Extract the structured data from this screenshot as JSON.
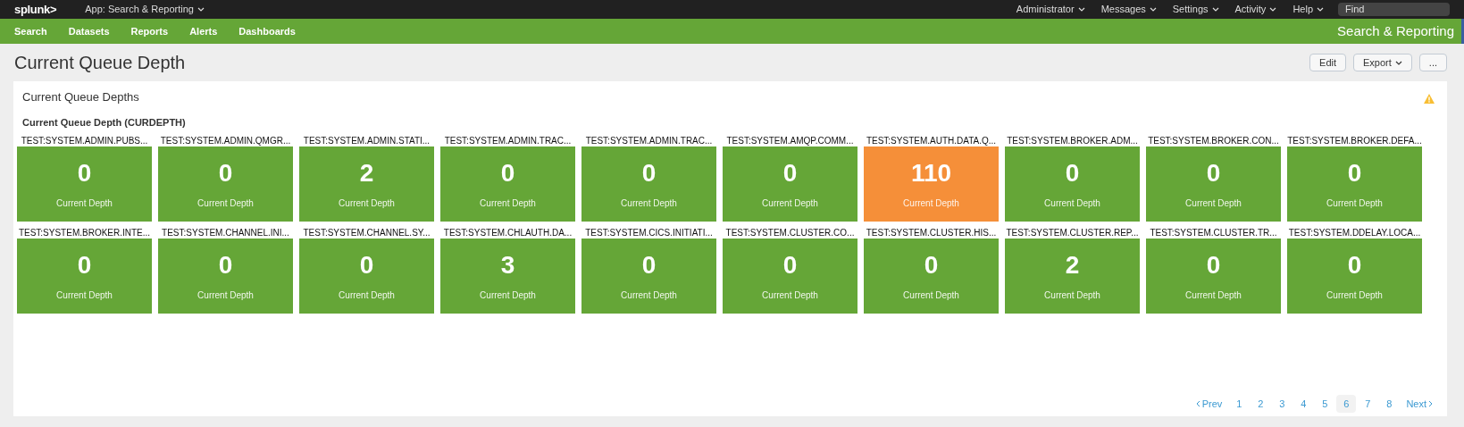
{
  "app_bar": {
    "logo": "splunk>",
    "app_menu": "App: Search & Reporting",
    "menus": [
      "Administrator",
      "Messages",
      "Settings",
      "Activity",
      "Help"
    ],
    "search": {
      "placeholder": "Find"
    }
  },
  "nav": {
    "items": [
      "Search",
      "Datasets",
      "Reports",
      "Alerts",
      "Dashboards"
    ],
    "app_title": "Search & Reporting"
  },
  "dashboard": {
    "title": "Current Queue Depth",
    "buttons": [
      {
        "label": "Edit",
        "kind": "plain"
      },
      {
        "label": "Export",
        "kind": "menu"
      },
      {
        "label": "...",
        "kind": "plain"
      }
    ]
  },
  "panel": {
    "title": "Current Queue Depths",
    "subtitle": "Current Queue Depth (CURDEPTH)",
    "warning": true,
    "tiles": [
      {
        "name": "TEST:SYSTEM.ADMIN.PUBS...",
        "value": "0",
        "caption": "Current Depth",
        "color": "#65a637"
      },
      {
        "name": "TEST:SYSTEM.ADMIN.QMGR...",
        "value": "0",
        "caption": "Current Depth",
        "color": "#65a637"
      },
      {
        "name": "TEST:SYSTEM.ADMIN.STATI...",
        "value": "2",
        "caption": "Current Depth",
        "color": "#65a637"
      },
      {
        "name": "TEST:SYSTEM.ADMIN.TRAC...",
        "value": "0",
        "caption": "Current Depth",
        "color": "#65a637"
      },
      {
        "name": "TEST:SYSTEM.ADMIN.TRAC...",
        "value": "0",
        "caption": "Current Depth",
        "color": "#65a637"
      },
      {
        "name": "TEST:SYSTEM.AMQP.COMM...",
        "value": "0",
        "caption": "Current Depth",
        "color": "#65a637"
      },
      {
        "name": "TEST:SYSTEM.AUTH.DATA.Q...",
        "value": "110",
        "caption": "Current Depth",
        "color": "#f58f39"
      },
      {
        "name": "TEST:SYSTEM.BROKER.ADM...",
        "value": "0",
        "caption": "Current Depth",
        "color": "#65a637"
      },
      {
        "name": "TEST:SYSTEM.BROKER.CON...",
        "value": "0",
        "caption": "Current Depth",
        "color": "#65a637"
      },
      {
        "name": "TEST:SYSTEM.BROKER.DEFA...",
        "value": "0",
        "caption": "Current Depth",
        "color": "#65a637"
      },
      {
        "name": "TEST:SYSTEM.BROKER.INTE...",
        "value": "0",
        "caption": "Current Depth",
        "color": "#65a637"
      },
      {
        "name": "TEST:SYSTEM.CHANNEL.INI...",
        "value": "0",
        "caption": "Current Depth",
        "color": "#65a637"
      },
      {
        "name": "TEST:SYSTEM.CHANNEL.SY...",
        "value": "0",
        "caption": "Current Depth",
        "color": "#65a637"
      },
      {
        "name": "TEST:SYSTEM.CHLAUTH.DA...",
        "value": "3",
        "caption": "Current Depth",
        "color": "#65a637"
      },
      {
        "name": "TEST:SYSTEM.CICS.INITIATI...",
        "value": "0",
        "caption": "Current Depth",
        "color": "#65a637"
      },
      {
        "name": "TEST:SYSTEM.CLUSTER.CO...",
        "value": "0",
        "caption": "Current Depth",
        "color": "#65a637"
      },
      {
        "name": "TEST:SYSTEM.CLUSTER.HIS...",
        "value": "0",
        "caption": "Current Depth",
        "color": "#65a637"
      },
      {
        "name": "TEST:SYSTEM.CLUSTER.REP...",
        "value": "2",
        "caption": "Current Depth",
        "color": "#65a637"
      },
      {
        "name": "TEST:SYSTEM.CLUSTER.TR...",
        "value": "0",
        "caption": "Current Depth",
        "color": "#65a637"
      },
      {
        "name": "TEST:SYSTEM.DDELAY.LOCA...",
        "value": "0",
        "caption": "Current Depth",
        "color": "#65a637"
      }
    ],
    "pagination": {
      "prev": "Prev",
      "next": "Next",
      "pages": [
        {
          "label": "1",
          "selected": false
        },
        {
          "label": "2",
          "selected": false
        },
        {
          "label": "3",
          "selected": false
        },
        {
          "label": "4",
          "selected": false
        },
        {
          "label": "5",
          "selected": false
        },
        {
          "label": "6",
          "selected": true
        },
        {
          "label": "7",
          "selected": false
        },
        {
          "label": "8",
          "selected": false
        }
      ]
    }
  }
}
